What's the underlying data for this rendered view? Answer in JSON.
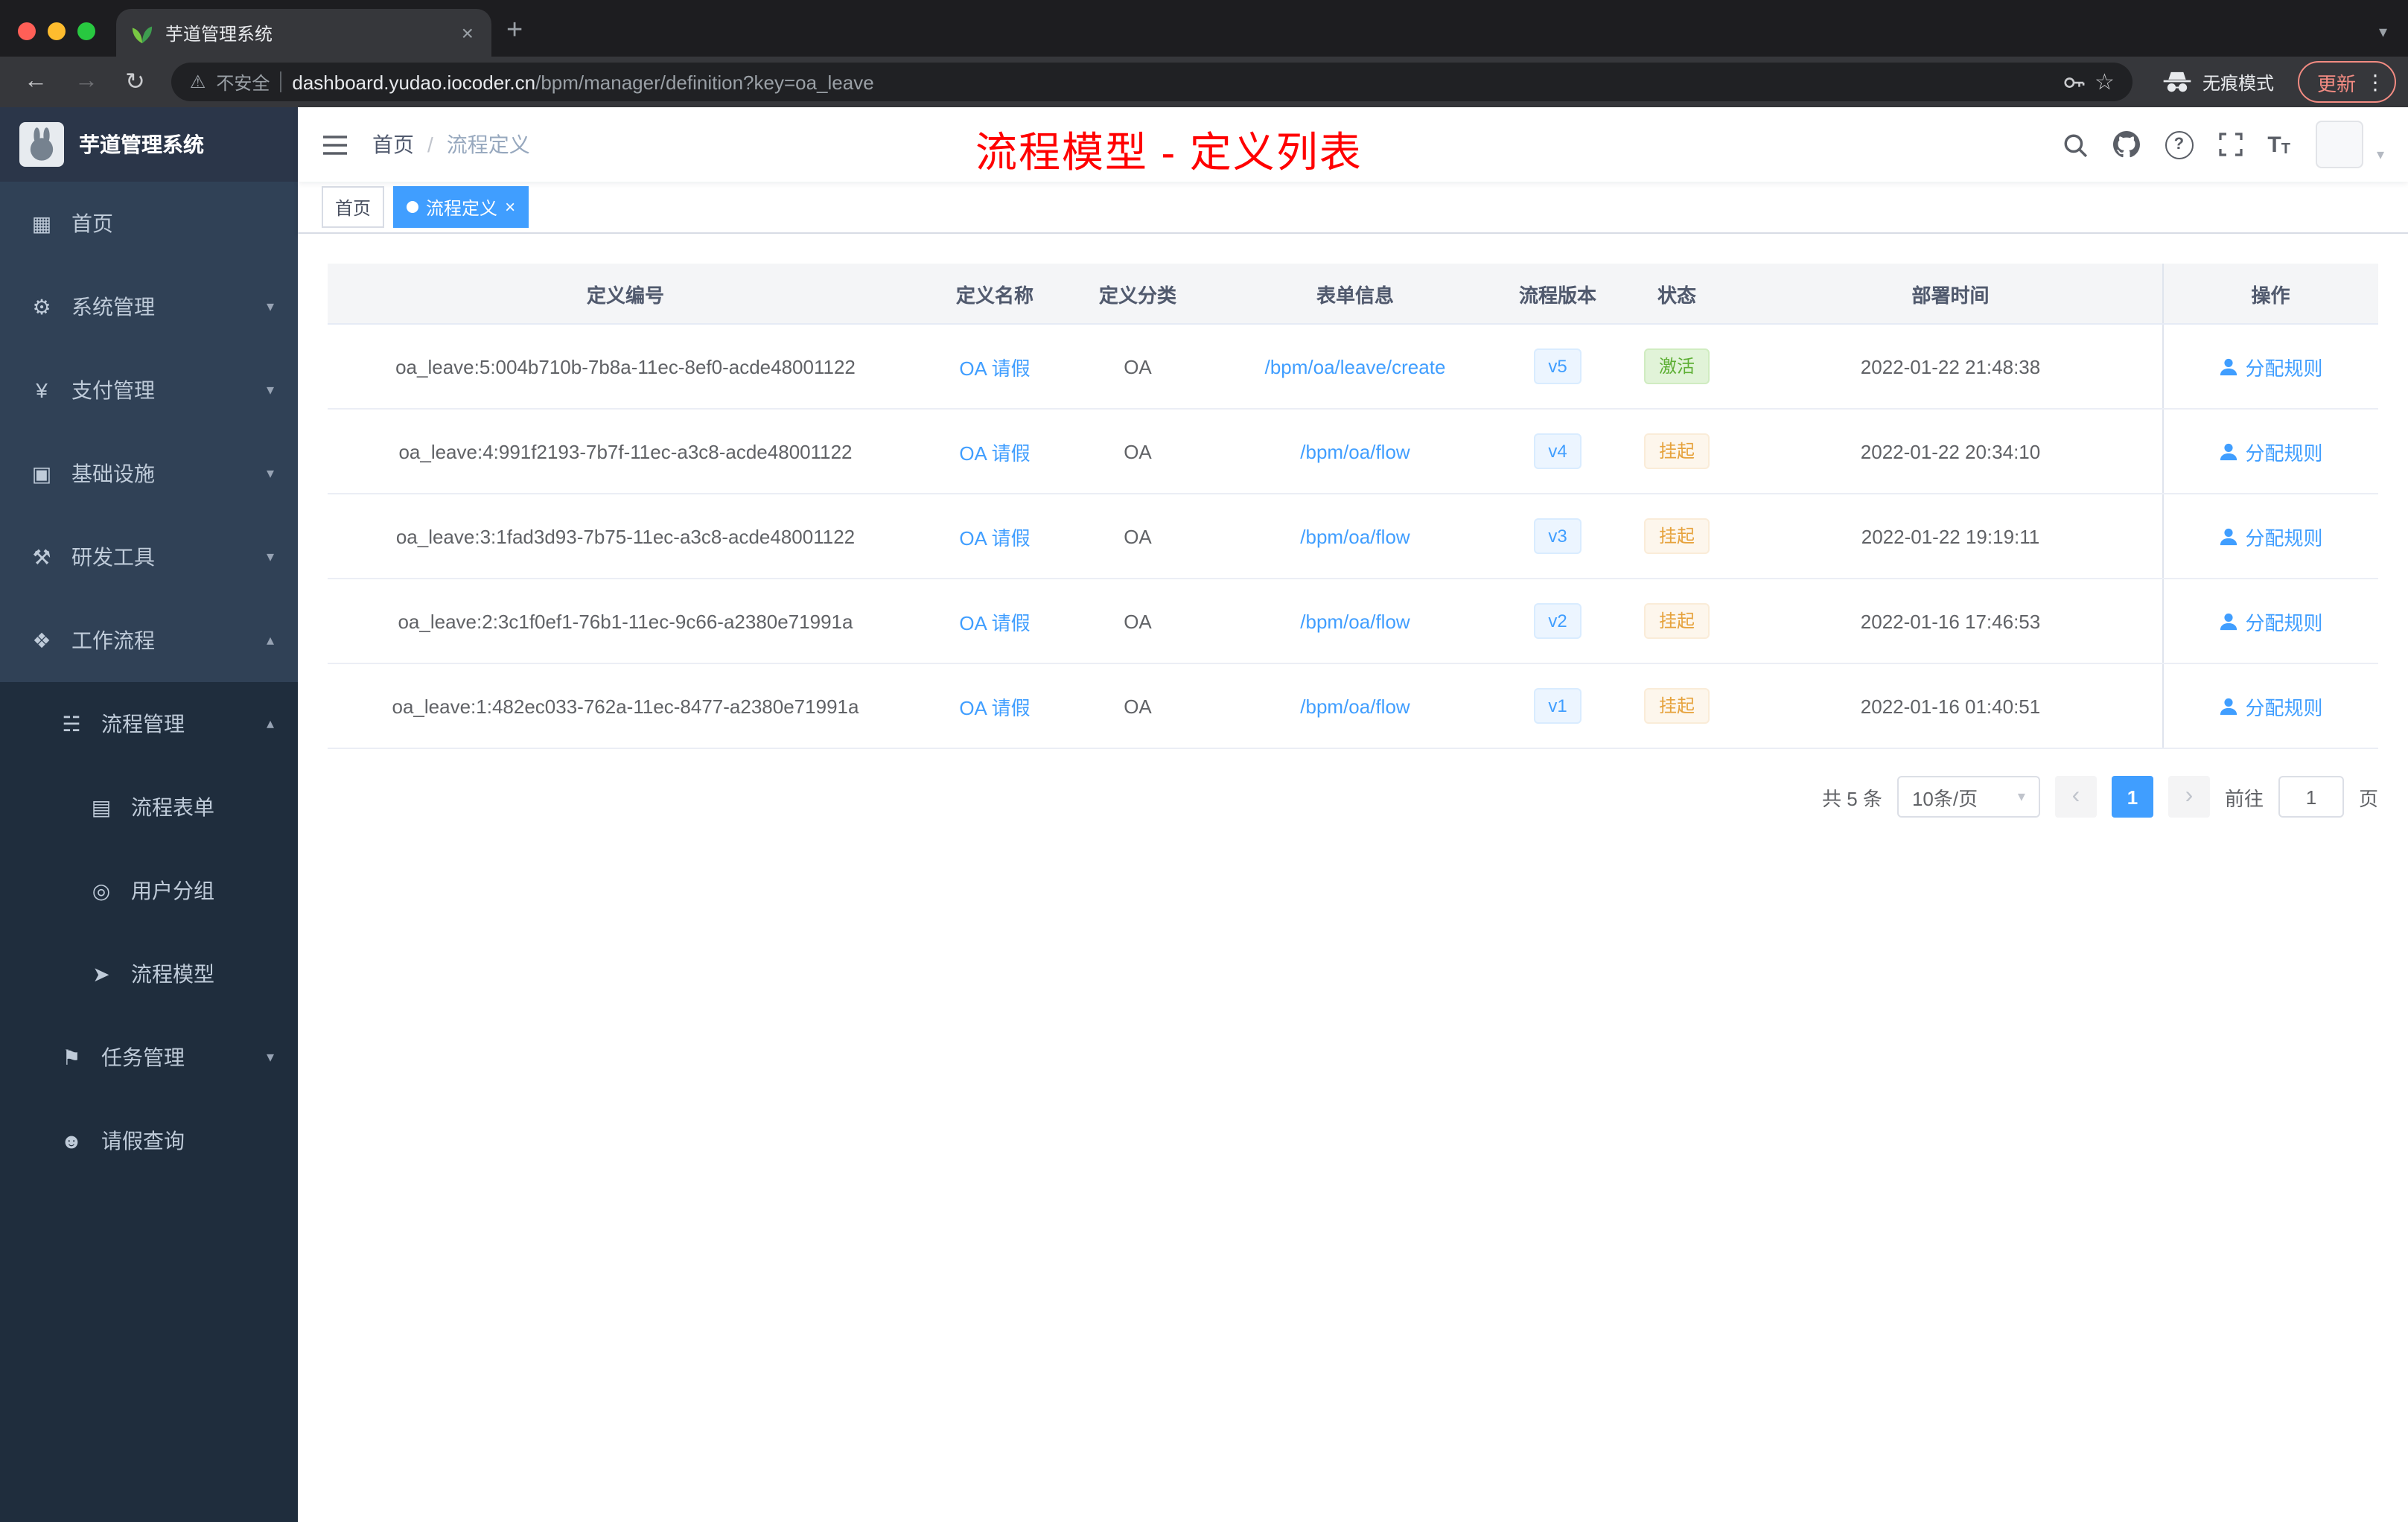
{
  "browser": {
    "tab_title": "芋道管理系统",
    "security_label": "不安全",
    "url_domain": "dashboard.yudao.iocoder.cn",
    "url_path": "/bpm/manager/definition?key=oa_leave",
    "incognito_label": "无痕模式",
    "update_label": "更新"
  },
  "icons": {
    "back": "←",
    "forward": "→",
    "reload": "↻",
    "warning": "⚠",
    "star": "☆",
    "menu_dots": "⋮",
    "close": "×",
    "plus": "+",
    "caret_down": "▾",
    "caret_up": "▴",
    "chevron_left": "‹",
    "chevron_right": "›",
    "help": "?",
    "dashboard": "▦",
    "system": "⚙",
    "payment": "¥",
    "infra": "▣",
    "devtools": "⚒",
    "workflow": "❖",
    "process": "☵",
    "form": "▤",
    "usergroup": "◎",
    "model": "➤",
    "task": "⚑",
    "person": "☻",
    "font_big": "T",
    "font_small": "T"
  },
  "sidebar": {
    "logo_title": "芋道管理系统",
    "items": [
      {
        "label": "首页"
      },
      {
        "label": "系统管理"
      },
      {
        "label": "支付管理"
      },
      {
        "label": "基础设施"
      },
      {
        "label": "研发工具"
      },
      {
        "label": "工作流程"
      },
      {
        "label": "流程管理"
      },
      {
        "label": "流程表单"
      },
      {
        "label": "用户分组"
      },
      {
        "label": "流程模型"
      },
      {
        "label": "任务管理"
      },
      {
        "label": "请假查询"
      }
    ]
  },
  "navbar": {
    "breadcrumb_home": "首页",
    "breadcrumb_separator": "/",
    "breadcrumb_current": "流程定义",
    "overlay_title": "流程模型 - 定义列表"
  },
  "tags": {
    "home": "首页",
    "current": "流程定义"
  },
  "table": {
    "columns": {
      "id": "定义编号",
      "name": "定义名称",
      "category": "定义分类",
      "form": "表单信息",
      "version": "流程版本",
      "status": "状态",
      "deploy": "部署时间",
      "actions": "操作"
    },
    "action_label": "分配规则",
    "rows": [
      {
        "id": "oa_leave:5:004b710b-7b8a-11ec-8ef0-acde48001122",
        "name": "OA 请假",
        "category": "OA",
        "form": "/bpm/oa/leave/create",
        "version": "v5",
        "status": "激活",
        "deploy": "2022-01-22 21:48:38"
      },
      {
        "id": "oa_leave:4:991f2193-7b7f-11ec-a3c8-acde48001122",
        "name": "OA 请假",
        "category": "OA",
        "form": "/bpm/oa/flow",
        "version": "v4",
        "status": "挂起",
        "deploy": "2022-01-22 20:34:10"
      },
      {
        "id": "oa_leave:3:1fad3d93-7b75-11ec-a3c8-acde48001122",
        "name": "OA 请假",
        "category": "OA",
        "form": "/bpm/oa/flow",
        "version": "v3",
        "status": "挂起",
        "deploy": "2022-01-22 19:19:11"
      },
      {
        "id": "oa_leave:2:3c1f0ef1-76b1-11ec-9c66-a2380e71991a",
        "name": "OA 请假",
        "category": "OA",
        "form": "/bpm/oa/flow",
        "version": "v2",
        "status": "挂起",
        "deploy": "2022-01-16 17:46:53"
      },
      {
        "id": "oa_leave:1:482ec033-762a-11ec-8477-a2380e71991a",
        "name": "OA 请假",
        "category": "OA",
        "form": "/bpm/oa/flow",
        "version": "v1",
        "status": "挂起",
        "deploy": "2022-01-16 01:40:51"
      }
    ]
  },
  "pagination": {
    "total": "共 5 条",
    "page_size": "10条/页",
    "page": "1",
    "goto_label": "前往",
    "goto_value": "1",
    "goto_unit": "页"
  },
  "colors": {
    "accent": "#409eff",
    "success": "#67c23a",
    "warning": "#e6a23c",
    "title_red": "#ff0000",
    "sidebar_bg": "#304156",
    "submenu_bg": "#1f2d3d",
    "tab_active": "#409eff"
  }
}
